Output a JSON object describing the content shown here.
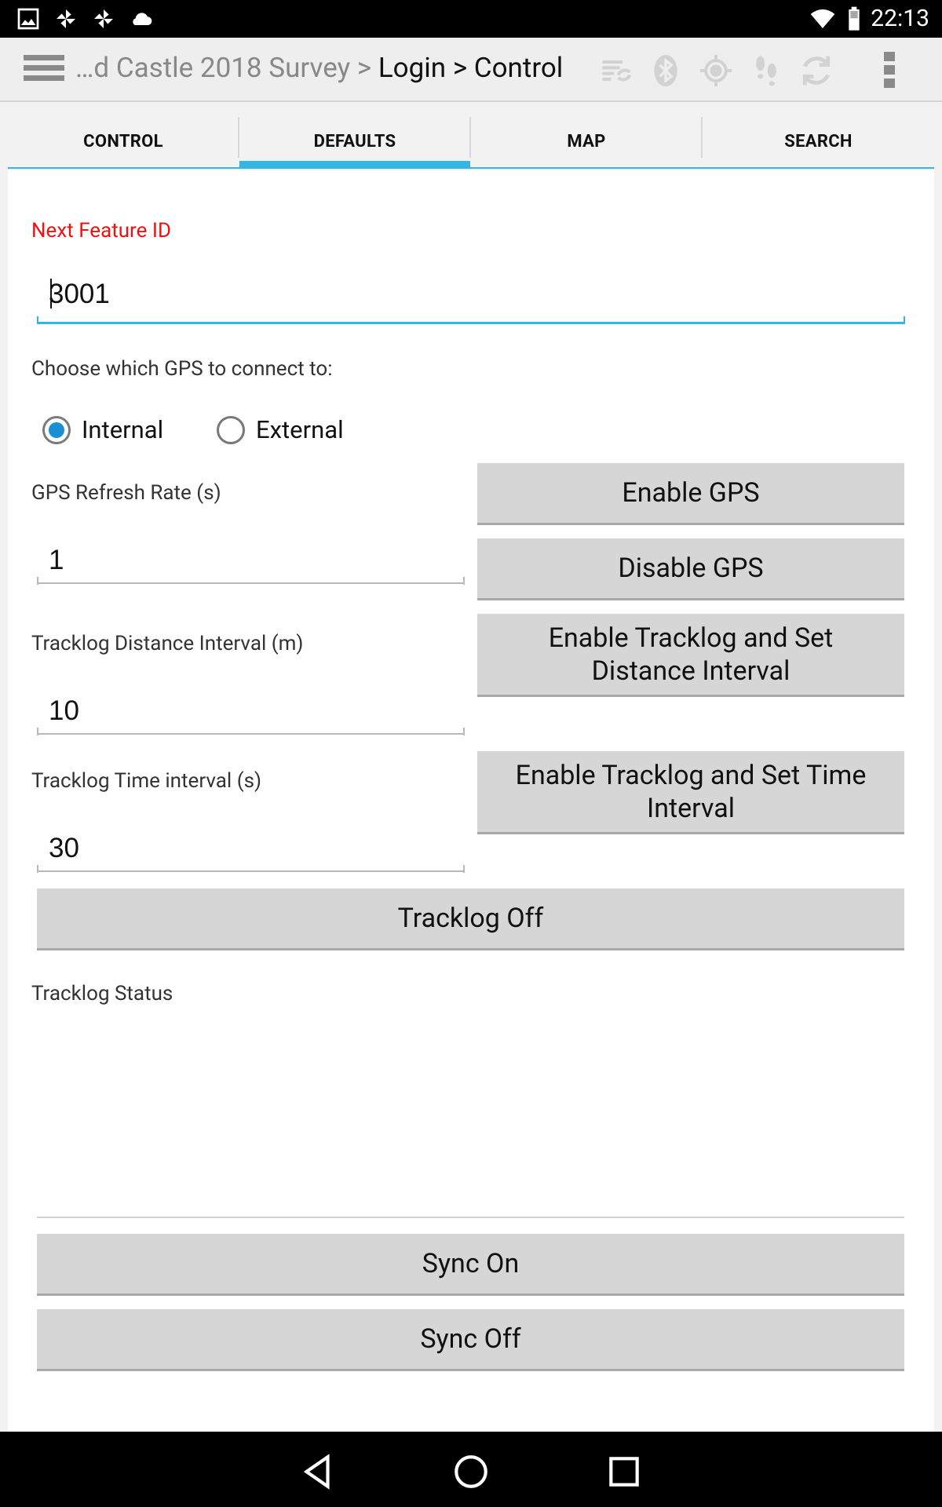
{
  "status_bar": {
    "time": "22:13",
    "left_icons": [
      "image-icon",
      "pinwheel-icon",
      "pinwheel-icon",
      "cloud-icon"
    ],
    "right_icons": [
      "wifi-icon",
      "battery-icon"
    ]
  },
  "action_bar": {
    "title_muted": "…d Castle 2018 Survey > ",
    "title_current": "Login > Control",
    "icons": [
      "sync-list-icon",
      "bluetooth-icon",
      "gps-target-icon",
      "footsteps-icon",
      "refresh-icon"
    ]
  },
  "tabs": [
    {
      "label": "CONTROL"
    },
    {
      "label": "DEFAULTS"
    },
    {
      "label": "MAP"
    },
    {
      "label": "SEARCH"
    }
  ],
  "form": {
    "next_feature_id_label": "Next Feature ID",
    "next_feature_id_value": "3001",
    "gps_choice_label": "Choose which GPS to connect to:",
    "gps_options": [
      {
        "label": "Internal",
        "checked": true
      },
      {
        "label": "External",
        "checked": false
      }
    ],
    "refresh_rate_label": "GPS Refresh Rate (s)",
    "refresh_rate_value": "1",
    "distance_interval_label": "Tracklog Distance Interval (m)",
    "distance_interval_value": "10",
    "time_interval_label": "Tracklog Time interval (s)",
    "time_interval_value": "30",
    "tracklog_status_label": "Tracklog Status"
  },
  "buttons": {
    "enable_gps": "Enable GPS",
    "disable_gps": "Disable GPS",
    "enable_distance_line1": "Enable Tracklog and Set",
    "enable_distance_line2": "Distance Interval",
    "enable_time_line1": "Enable Tracklog and Set Time",
    "enable_time_line2": "Interval",
    "tracklog_off": "Tracklog Off",
    "sync_on": "Sync On",
    "sync_off": "Sync Off"
  },
  "colors": {
    "accent": "#33b5e5",
    "radio_checked": "#1a8fd4",
    "error_label": "#ee1111"
  },
  "nav_bar": {
    "icons": [
      "back-icon",
      "home-icon",
      "recents-icon"
    ]
  }
}
